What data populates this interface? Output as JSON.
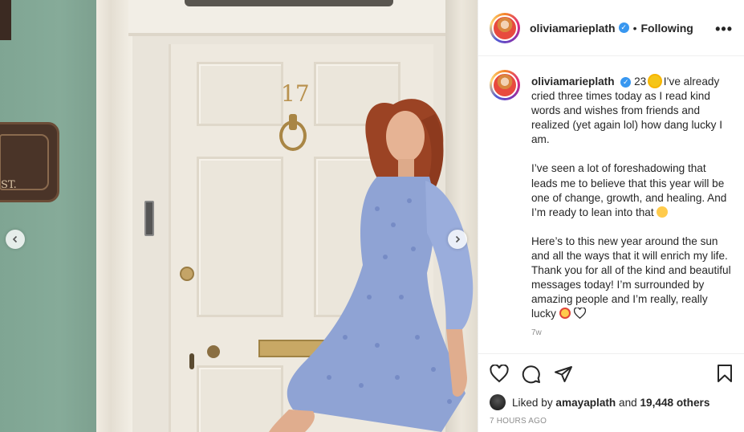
{
  "photo": {
    "house_number": "17",
    "plaque_text": "ST."
  },
  "post": {
    "username": "oliviamarieplath",
    "follow_status": "Following",
    "more_icon": "ellipsis-icon",
    "caption_user": "oliviamarieplath",
    "caption_p1": "23 ",
    "caption_p1_rest": " I’ve already cried three times today as I read kind words and wishes from friends and realized (yet again lol) how dang lucky I am.",
    "caption_p2": "I’ve seen a lot of foreshadowing that leads me to believe that this year will be one of change, growth, and healing. And I’m ready to lean into that ",
    "caption_p3": "Here’s to this new year around the sun and all the ways that it will enrich my life. Thank you for all of the kind and beautiful messages today! I’m surrounded by amazing people and I’m really, really lucky ",
    "trailing": "7w"
  },
  "engagement": {
    "liked_prefix": "Liked by ",
    "liked_user": "amayaplath",
    "liked_mid": " and ",
    "liked_count": "19,448 others",
    "time": "7 HOURS AGO"
  },
  "icons": [
    "heart-icon",
    "comment-icon",
    "share-icon",
    "bookmark-icon",
    "chevron-left-icon",
    "chevron-right-icon"
  ],
  "colors": {
    "verified": "#3897f0",
    "text": "#262626",
    "muted": "#8e8e8e"
  }
}
